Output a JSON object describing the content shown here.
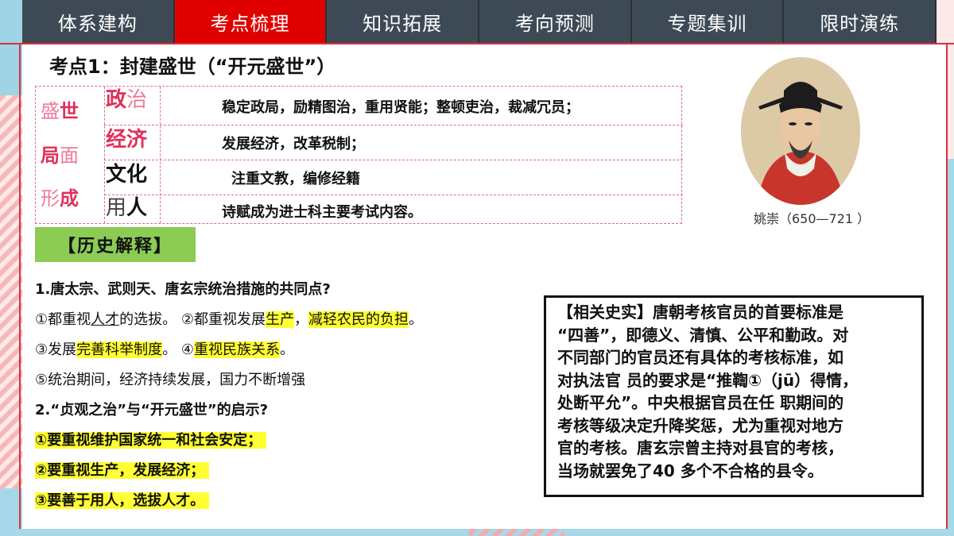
{
  "nav": {
    "tabs": [
      "体系建构",
      "考点梳理",
      "知识拓展",
      "考向预测",
      "专题集训",
      "限时演练"
    ],
    "active_index": 1
  },
  "heading": "考点1：封建盛世（“开元盛世”）",
  "table": {
    "left_chars": [
      [
        {
          "t": "盛",
          "s": "pink"
        },
        {
          "t": "世",
          "s": "pinkb"
        }
      ],
      [
        {
          "t": "局",
          "s": "pinkb"
        },
        {
          "t": "面",
          "s": "pink"
        }
      ],
      [
        {
          "t": "形",
          "s": "pink"
        },
        {
          "t": "成",
          "s": "pinkb"
        }
      ]
    ],
    "rows": [
      {
        "cat_a": "政",
        "cat_b": "治",
        "text": "稳定政局，励精图治，重用贤能；整顿吏治，裁减冗员；"
      },
      {
        "cat_a": "经济",
        "cat_b": "",
        "text": "发展经济，改革税制；"
      },
      {
        "cat_a": "文化",
        "cat_b": "",
        "text": "注重文教，编修经籍"
      },
      {
        "cat_a": "用",
        "cat_b": "人",
        "text": "诗赋成为进士科主要考试内容。"
      }
    ]
  },
  "portrait": {
    "caption": "姚崇（650—721 ）"
  },
  "hist_label": "【历史解释】",
  "questions": {
    "q1": "1.唐太宗、武则天、唐玄宗统治措施的共同点?",
    "a1_p1": "①都重视",
    "a1_u": "人才",
    "a1_p2": "的选拔。 ②都重视发展",
    "a1_h1": "生产",
    "a1_p3": "，",
    "a1_h2": "减轻农民的负担",
    "a1_p4": "。",
    "a2_p1": "③发展",
    "a2_h1": "完善科举制度",
    "a2_p2": "。 ④",
    "a2_h2": "重视民族关系",
    "a2_p3": "。",
    "a3": "⑤统治期间，经济持续发展，国力不断增强",
    "q2": "2.“贞观之治”与“开元盛世”的启示?",
    "b1": "①要重视维护国家统一和社会安定；",
    "b2": "②要重视生产，发展经济；",
    "b3": "③要善于用人，选拔人才。"
  },
  "fact_box": {
    "lines": [
      "【相关史实】唐朝考核官员的首要标准是",
      "“四善”，即德义、清慎、公平和勤政。对",
      "不同部门的官员还有具体的考核标准，如",
      "对执法官 员的要求是“推鞫①（jū）得情，",
      "处断平允”。中央根据官员在任 职期间的",
      "考核等级决定升降奖惩，尤为重视对地方",
      "官的考核。唐玄宗曾主持对县官的考核，",
      "当场就罢免了40 多个不合格的县令。"
    ]
  },
  "colors": {
    "nav": "#3d4a55",
    "nav_active": "#e00000",
    "highlight": "#ffff33",
    "label_green": "#8ccc55",
    "accent_pink": "#e0305a"
  }
}
